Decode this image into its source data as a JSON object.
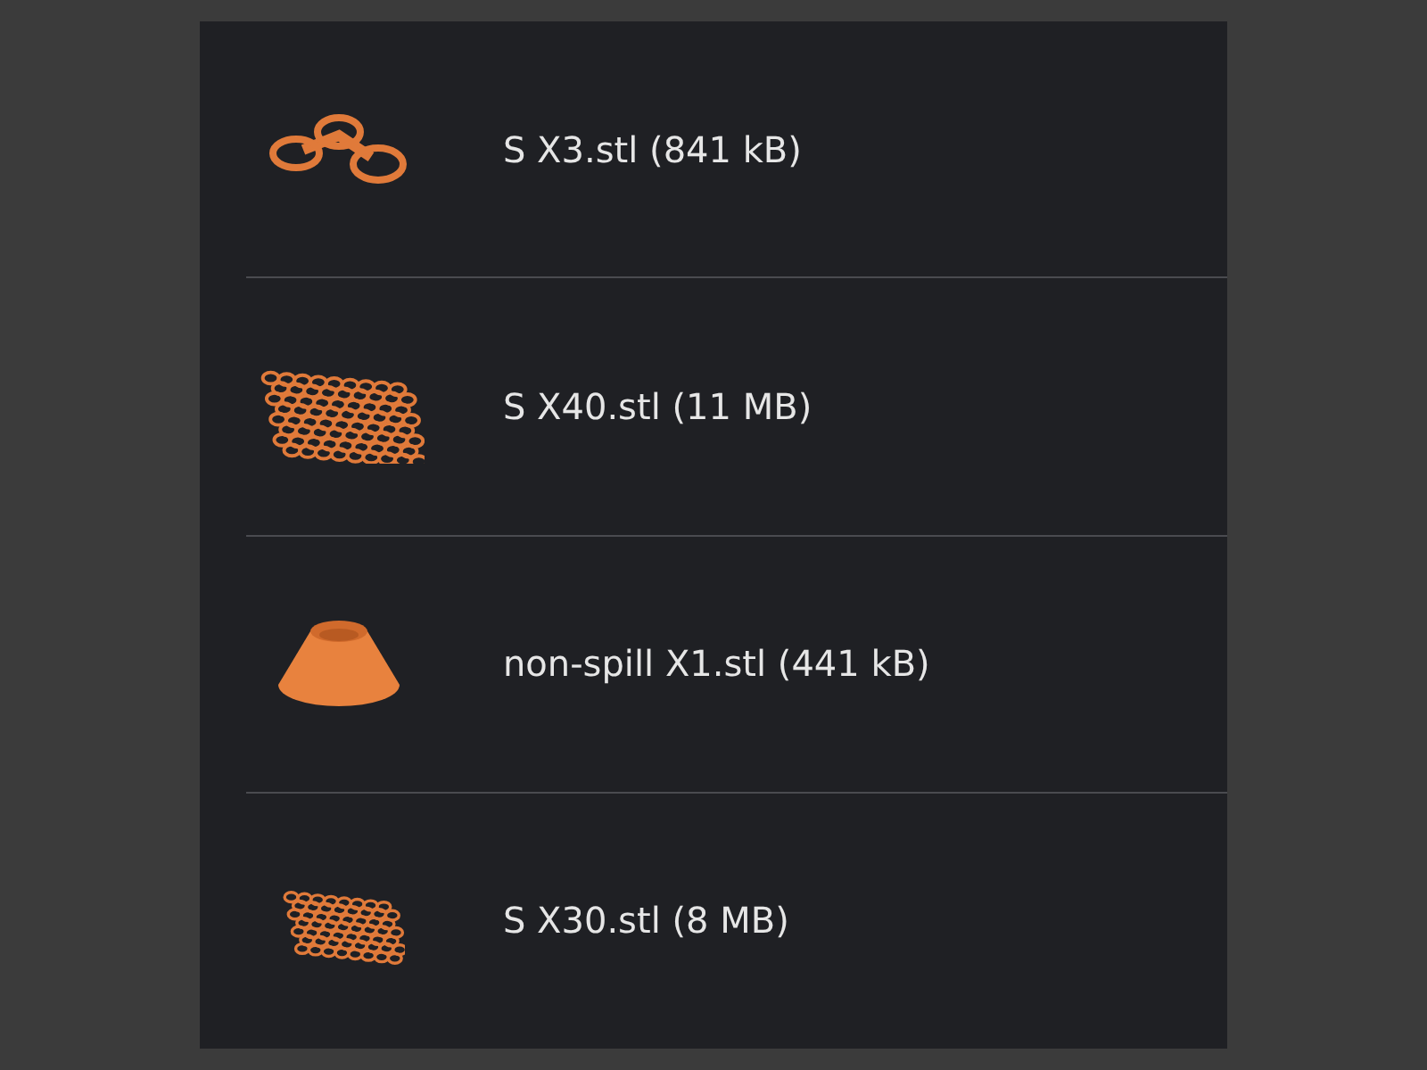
{
  "files": [
    {
      "name": "S X3.stl (841 kB)",
      "kind": "rings"
    },
    {
      "name": "S X40.stl (11 MB)",
      "kind": "grid-large"
    },
    {
      "name": "non-spill X1.stl (441 kB)",
      "kind": "cone"
    },
    {
      "name": "S X30.stl (8 MB)",
      "kind": "grid-small"
    }
  ]
}
